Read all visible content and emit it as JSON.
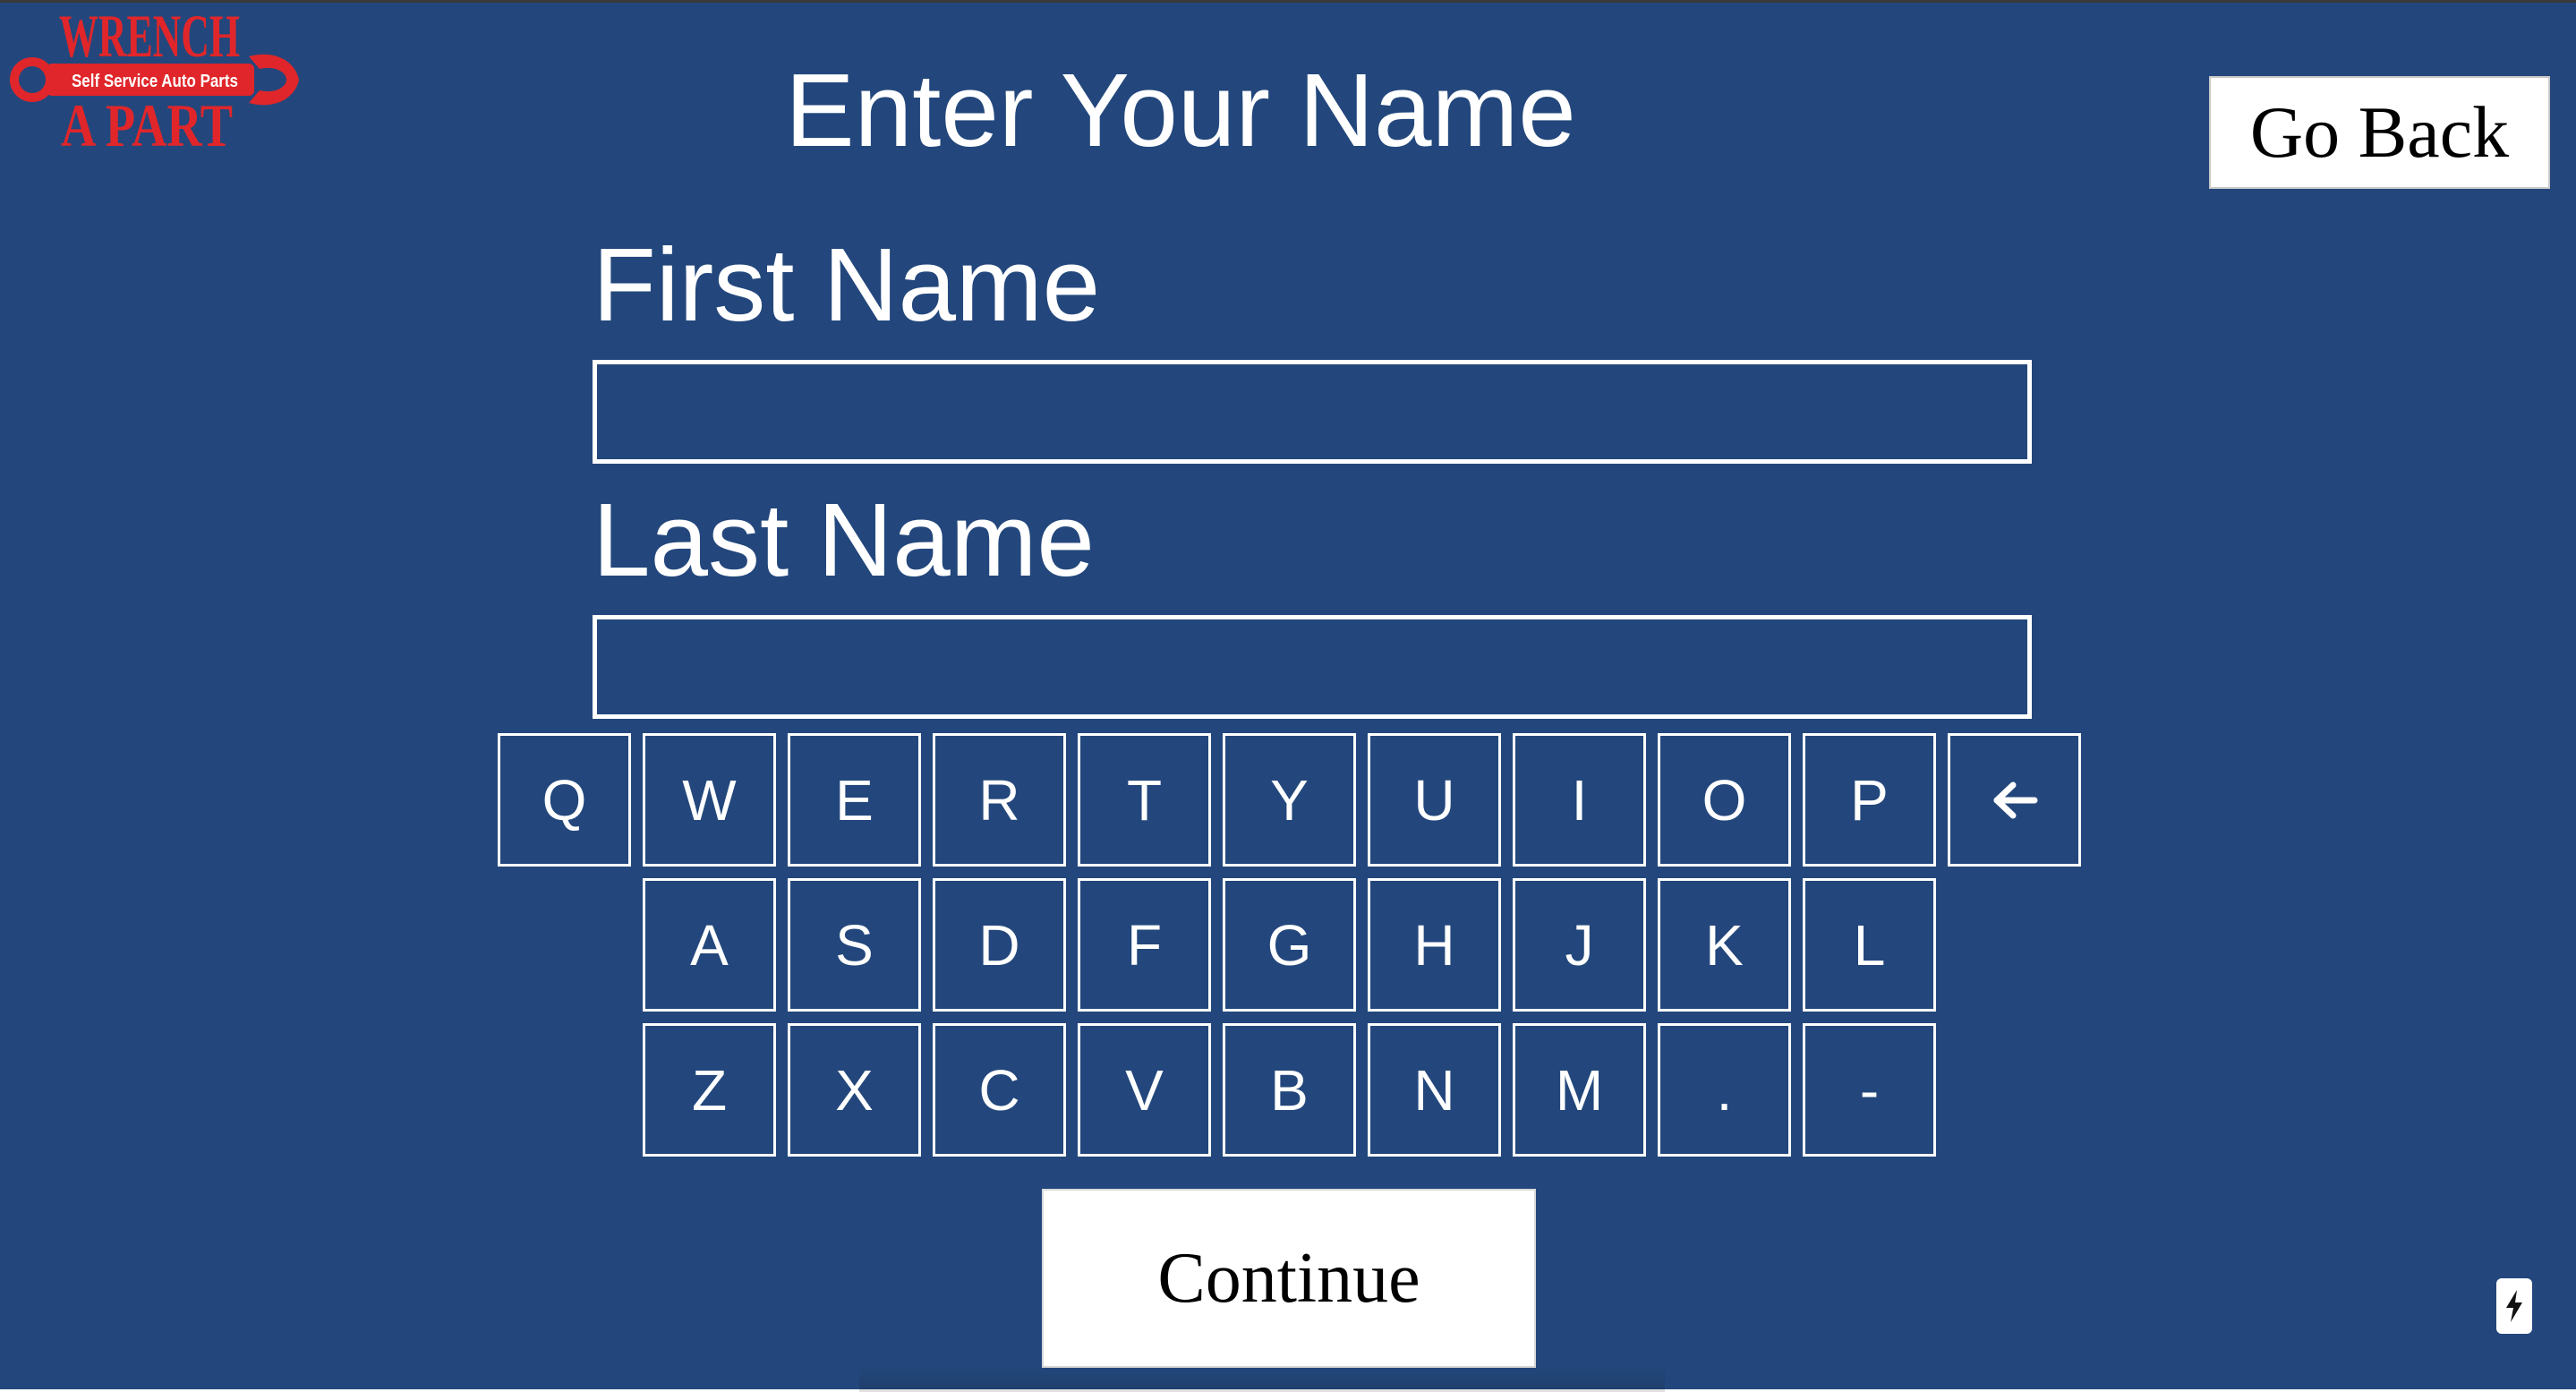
{
  "logo": {
    "line1": "WRENCH",
    "line2": "A PART",
    "tagline": "Self Service Auto Parts",
    "icon": "wrench-logo-icon",
    "brand_color": "#e0262a"
  },
  "header": {
    "title": "Enter Your Name",
    "go_back_label": "Go Back"
  },
  "form": {
    "first_name_label": "First Name",
    "first_name_value": "",
    "last_name_label": "Last Name",
    "last_name_value": ""
  },
  "keyboard": {
    "rows": [
      [
        "Q",
        "W",
        "E",
        "R",
        "T",
        "Y",
        "U",
        "I",
        "O",
        "P"
      ],
      [
        "A",
        "S",
        "D",
        "F",
        "G",
        "H",
        "J",
        "K",
        "L"
      ],
      [
        "Z",
        "X",
        "C",
        "V",
        "B",
        "N",
        "M",
        ".",
        "-"
      ]
    ],
    "backspace_icon": "backspace-arrow-icon"
  },
  "actions": {
    "continue_label": "Continue"
  },
  "corner_badge": {
    "icon": "lightning-bolt-icon"
  },
  "colors": {
    "background": "#23477c",
    "foreground": "#ffffff",
    "button_background": "#ffffff",
    "button_text": "#000000"
  }
}
